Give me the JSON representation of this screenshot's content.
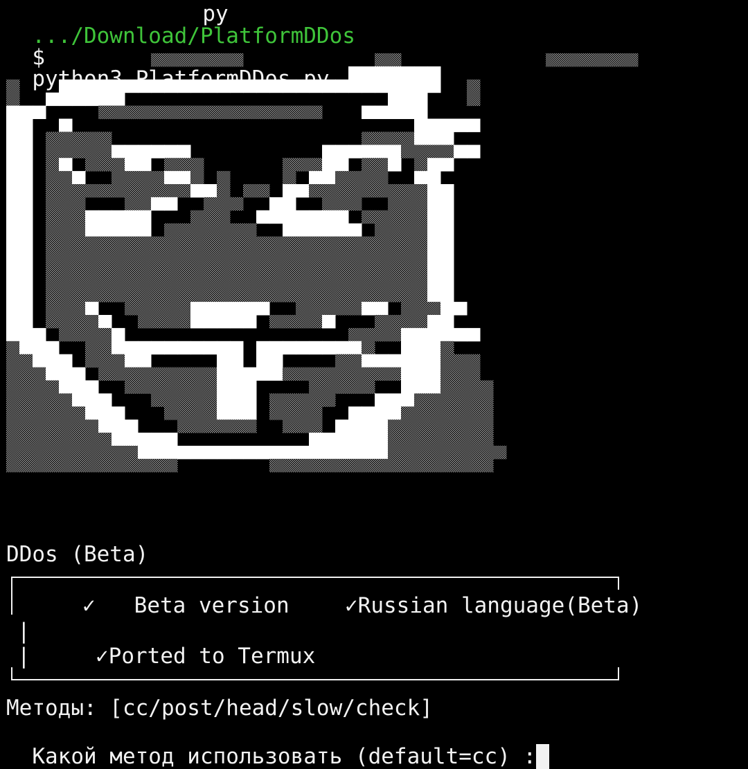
{
  "terminal": {
    "prompt_path": ".../Download/PlatformDDos",
    "prompt_symbol": "$",
    "command": "python3 PlatformDDos.py",
    "clipped_top_fragment": "py"
  },
  "banner": {
    "title": "DDos (Beta)",
    "features": [
      "✓   Beta version",
      "✓Russian language(Beta)",
      "✓Ported to Termux"
    ],
    "box_side_marks": [
      "|",
      "|"
    ]
  },
  "menu": {
    "methods_line": "Методы: [cc/post/head/slow/check]",
    "question": "Какой метод использовать (default=cc) :"
  },
  "colors": {
    "background": "#000000",
    "foreground": "#f2f2f2",
    "prompt_path": "#3fc43a",
    "shade_light": "#ffffff",
    "shade_medium": "#7a7a7a"
  },
  "art": {
    "name": "guy-fawkes-mask-ascii-art",
    "shading_scale": [
      ".",
      "#",
      "/"
    ],
    "rows": [
      "...........#######..........##...........#######.........",
      "..........................///////.......................",
      "#.../////////////////////////////..#....................",
      "#..//////....................///...#.....................",
      "///....#################.../////........................",
      "//../........................../////....................",
      "//.#####...................####///......................",
      "//.#####//////..........//////####//....................",
      "//.#/.###//.###......###//.##/.#//......................",
      "//.##/..####//#.#....#.//####..//.......................",
      "//.###########//#.##.//#########//......................",
      "//.###...##//..###..//..###..###//......................",
      "//.###/////...###..///////.#####//......................",
      "//.###/////.#######..//////.####//......................",
      "//.#############################//......................",
      "//.#############################//......................",
      "//.#############################//......................",
      "//.#############################//......................",
      "//.#############################//......................",
      "//.###/..#####//////..#####//.###//.....................",
      "//.####/..####/////.####/...####//......................",
      "///.####/.................####//////....................",
      "#///..##//////////.////////#..///#......................",
      "##///.###//.....//.//....##//////###....................",
      "###///.#########/////#########///###....................",
      "####///..#######///....#####..///####...................",
      "#####///...#####///.#####...///######...................",
      "######///...####///.####..////#######...................",
      "#######///...######..###.////########...................",
      "########/////..........//////########...................",
      "##########///////////////////#########..................",
      "#############.......#################..................."
    ]
  }
}
